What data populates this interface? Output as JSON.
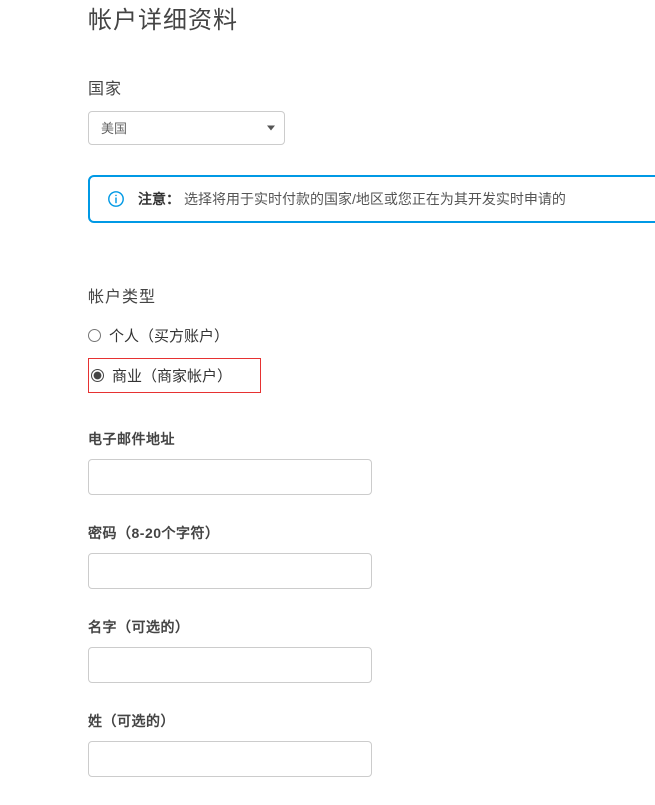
{
  "page": {
    "title": "帐户详细资料"
  },
  "country": {
    "label": "国家",
    "selected": "美国"
  },
  "notice": {
    "label": "注意：",
    "body": "选择将用于实时付款的国家/地区或您正在为其开发实时申请的"
  },
  "account_type": {
    "label": "帐户类型",
    "options": [
      {
        "label": "个人（买方账户）",
        "checked": false,
        "highlighted": false
      },
      {
        "label": "商业（商家帐户）",
        "checked": true,
        "highlighted": true
      }
    ]
  },
  "fields": {
    "email": {
      "label": "电子邮件地址",
      "value": ""
    },
    "password": {
      "label": "密码（8-20个字符）",
      "value": ""
    },
    "first_name": {
      "label": "名字（可选的）",
      "value": ""
    },
    "last_name": {
      "label": "姓（可选的）",
      "value": ""
    }
  }
}
